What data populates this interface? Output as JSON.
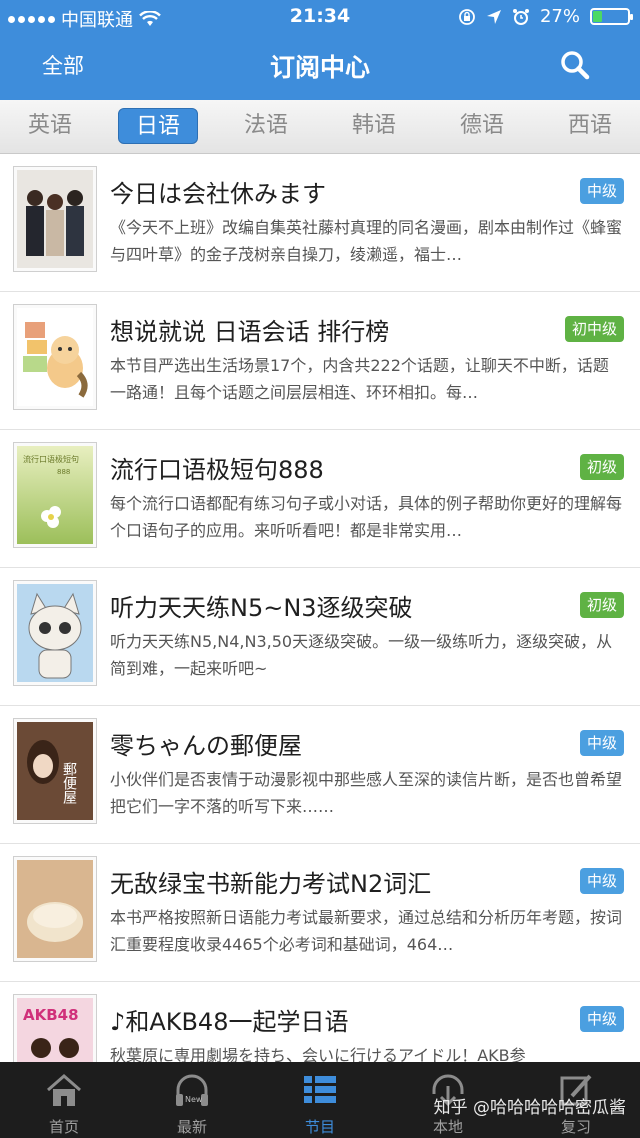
{
  "status_bar": {
    "carrier": "中国联通",
    "time": "21:34",
    "battery": "27%",
    "battery_level": 0.27
  },
  "nav": {
    "left_label": "全部",
    "title": "订阅中心",
    "search_icon": "search-icon"
  },
  "tabs": [
    {
      "label": "英语"
    },
    {
      "label": "日语",
      "active": true
    },
    {
      "label": "法语"
    },
    {
      "label": "韩语"
    },
    {
      "label": "德语"
    },
    {
      "label": "西语"
    }
  ],
  "items": [
    {
      "title": "今日は会社休みます",
      "desc": "《今天不上班》改编自集英社藤村真理的同名漫画，剧本由制作过《蜂蜜与四叶草》的金子茂树亲自操刀，绫濑遥，福士…",
      "badge": "中级",
      "badge_color": "#4b9fe0"
    },
    {
      "title": "想说就说 日语会话 排行榜",
      "desc": "本节目严选出生活场景17个，内含共222个话题，让聊天不中断，话题一路通！且每个话题之间层层相连、环环相扣。每…",
      "badge": "初中级",
      "badge_color": "#5fb244"
    },
    {
      "title": "流行口语极短句888",
      "desc": "每个流行口语都配有练习句子或小对话，具体的例子帮助你更好的理解每个口语句子的应用。来听听看吧！都是非常实用…",
      "badge": "初级",
      "badge_color": "#5fb244",
      "thumb_text": "流行口语极短句",
      "thumb_sub": "888"
    },
    {
      "title": "听力天天练N5~N3逐级突破",
      "desc": "听力天天练N5,N4,N3,50天逐级突破。一级一级练听力，逐级突破，从简到难，一起来听吧~",
      "badge": "初级",
      "badge_color": "#5fb244"
    },
    {
      "title": "零ちゃんの郵便屋",
      "desc": "小伙伴们是否衷情于动漫影视中那些感人至深的读信片断，是否也曾希望把它们一字不落的听写下来……",
      "badge": "中级",
      "badge_color": "#4b9fe0",
      "thumb_text": "郵便屋"
    },
    {
      "title": "无敌绿宝书新能力考试N2词汇",
      "desc": "本书严格按照新日语能力考试最新要求，通过总结和分析历年考题，按词汇重要程度收录4465个必考词和基础词，464…",
      "badge": "中级",
      "badge_color": "#4b9fe0"
    },
    {
      "title": "♪和AKB48一起学日语",
      "desc": "秋葉原に専用劇場を持ち、会いに行けるアイドル！AKB参",
      "badge": "中级",
      "badge_color": "#4b9fe0",
      "thumb_text": "AKB48"
    }
  ],
  "tabbar": [
    {
      "label": "首页",
      "icon": "home-icon"
    },
    {
      "label": "最新",
      "icon": "headphones-new-icon",
      "icon_text": "New"
    },
    {
      "label": "节目",
      "icon": "list-icon",
      "active": true
    },
    {
      "label": "本地",
      "icon": "download-icon"
    },
    {
      "label": "复习",
      "icon": "edit-icon"
    }
  ],
  "watermark": "知乎 @哈哈哈哈哈密瓜酱"
}
